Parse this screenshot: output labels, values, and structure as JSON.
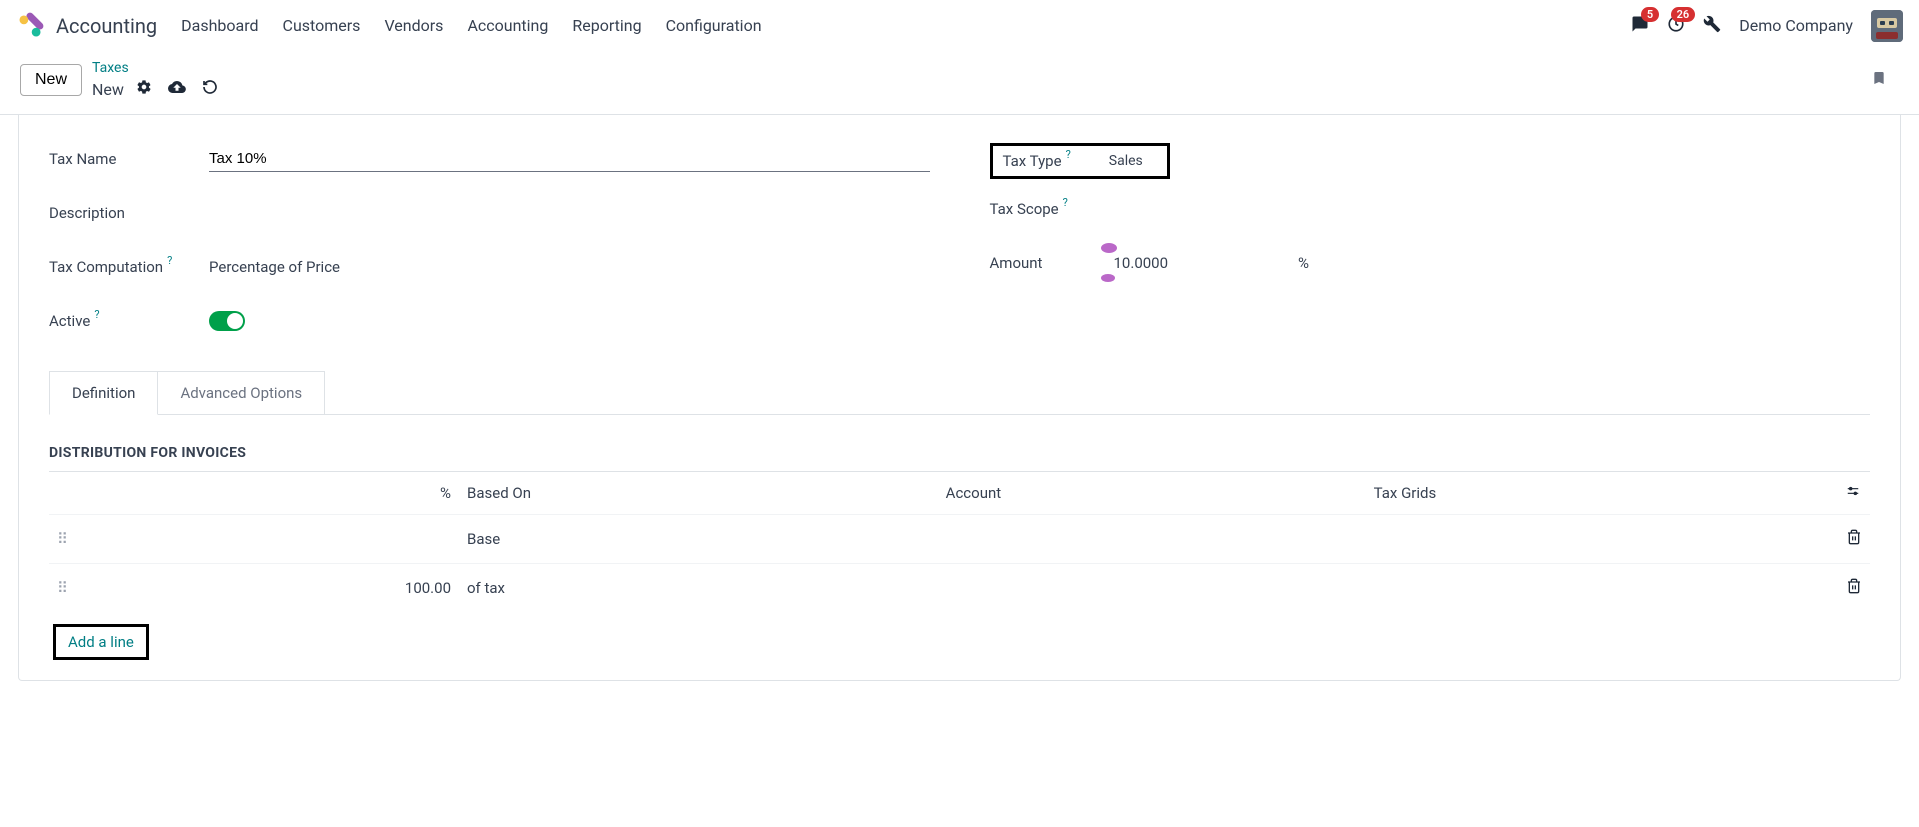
{
  "app": {
    "name": "Accounting"
  },
  "nav": {
    "items": [
      "Dashboard",
      "Customers",
      "Vendors",
      "Accounting",
      "Reporting",
      "Configuration"
    ]
  },
  "badges": {
    "messages": "5",
    "activities": "26"
  },
  "company": "Demo Company",
  "subbar": {
    "new_btn": "New",
    "breadcrumb_link": "Taxes",
    "breadcrumb_current": "New"
  },
  "form": {
    "tax_name_label": "Tax Name",
    "tax_name_value": "Tax 10%",
    "description_label": "Description",
    "tax_computation_label": "Tax Computation",
    "tax_computation_value": "Percentage of Price",
    "active_label": "Active",
    "tax_type_label": "Tax Type",
    "tax_type_value": "Sales",
    "tax_scope_label": "Tax Scope",
    "amount_label": "Amount",
    "amount_value": "10.0000",
    "percent": "%"
  },
  "tabs": {
    "definition": "Definition",
    "advanced": "Advanced Options"
  },
  "distribution": {
    "title": "DISTRIBUTION FOR INVOICES",
    "headers": {
      "percent": "%",
      "based_on": "Based On",
      "account": "Account",
      "tax_grids": "Tax Grids"
    },
    "rows": [
      {
        "percent": "",
        "based_on": "Base"
      },
      {
        "percent": "100.00",
        "based_on": "of tax"
      }
    ],
    "add_line": "Add a line"
  }
}
